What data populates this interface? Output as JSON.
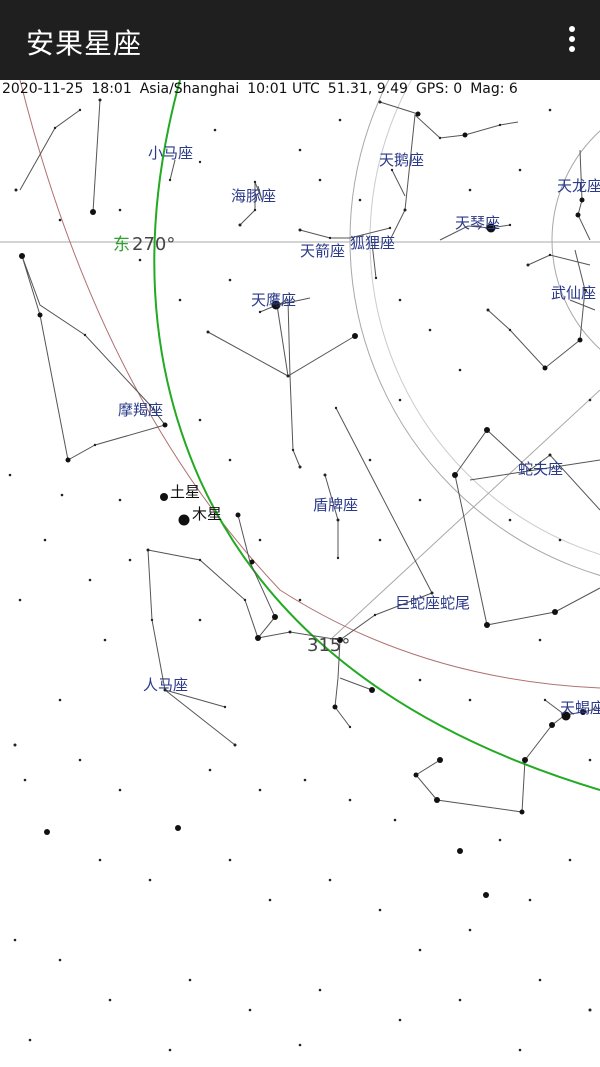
{
  "app": {
    "title": "安果星座"
  },
  "status": {
    "date": "2020-11-25",
    "time": "18:01",
    "timezone": "Asia/Shanghai",
    "utc": "10:01 UTC",
    "coords": "51.31, 9.49",
    "gps": "GPS: 0",
    "mag": "Mag: 6"
  },
  "horizon": {
    "east_label": "东",
    "east_degree": "270°",
    "degree_315": "315°"
  },
  "constellations": {
    "equuleus": "小马座",
    "delphinus": "海豚座",
    "sagitta": "天箭座",
    "vulpecula": "狐狸座",
    "cygnus": "天鹅座",
    "lyra": "天琴座",
    "draco": "天龙座",
    "hercules": "武仙座",
    "aquila": "天鹰座",
    "capricornus": "摩羯座",
    "scutum": "盾牌座",
    "ophiuchus": "蛇夫座",
    "serpens_cauda": "巨蛇座蛇尾",
    "sagittarius": "人马座",
    "scorpius": "天蝎座"
  },
  "planets": {
    "saturn": "土星",
    "jupiter": "木星"
  },
  "colors": {
    "horizon": "#22aa22",
    "ecliptic": "#b07070",
    "grid": "#a8a8a8",
    "constellation_lines": "#555555",
    "labels": "#2b3a8a"
  }
}
